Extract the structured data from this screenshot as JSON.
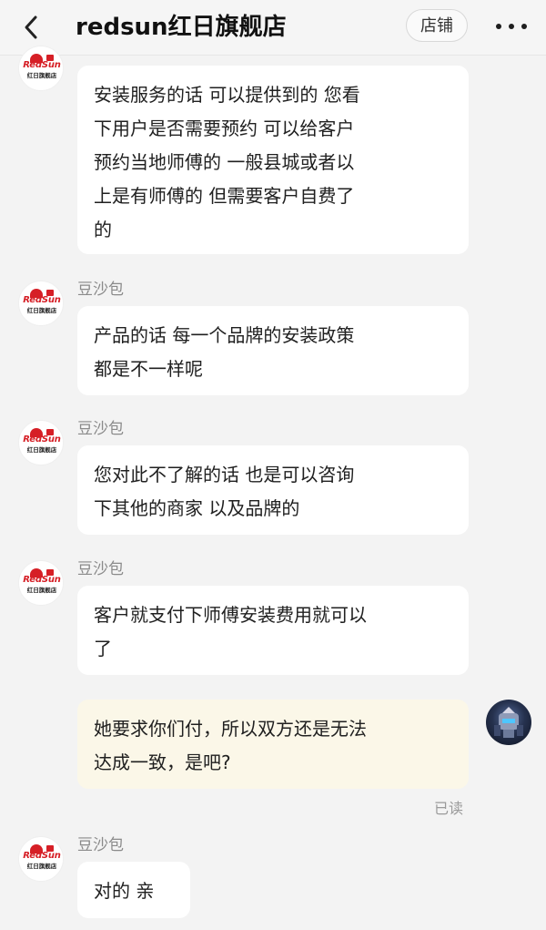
{
  "header": {
    "title": "redsun红日旗舰店",
    "store_label": "店铺"
  },
  "store_logo": {
    "brand": "RedSun",
    "name": "红日旗舰店"
  },
  "messages": [
    {
      "text": "安装服务的话 可以提供到的 您看\n下用户是否需要预约 可以给客户\n预约当地师傅的 一般县城或者以\n上是有师傅的 但需要客户自费了\n的"
    },
    {
      "sender": "豆沙包",
      "text": "产品的话 每一个品牌的安装政策\n都是不一样呢"
    },
    {
      "sender": "豆沙包",
      "text": "您对此不了解的话 也是可以咨询\n下其他的商家 以及品牌的"
    },
    {
      "sender": "豆沙包",
      "text": "客户就支付下师傅安装费用就可以\n了"
    },
    {
      "text": "她要求你们付，所以双方还是无法\n达成一致，是吧?",
      "status": "已读"
    },
    {
      "sender": "豆沙包",
      "text": "对的 亲"
    }
  ],
  "colors": {
    "background": "#f3f3f3",
    "bubble": "#ffffff",
    "user_bubble": "#fbf7e8",
    "brand_red": "#d61f26"
  }
}
